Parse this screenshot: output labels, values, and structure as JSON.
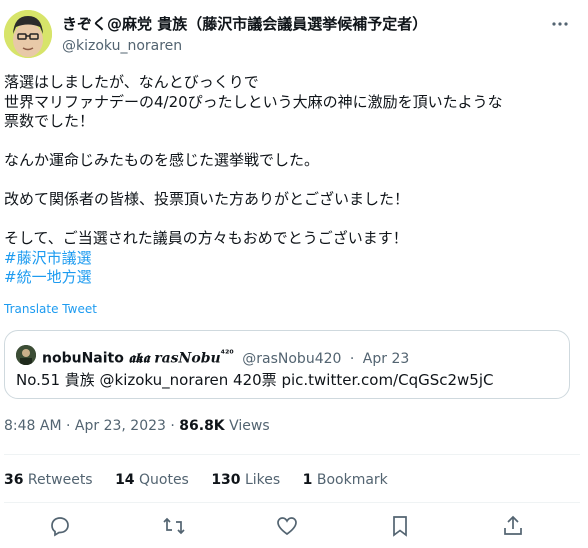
{
  "author": {
    "display_name": "きぞく@麻党 貴族（藤沢市議会議員選挙候補予定者）",
    "handle": "@kizoku_noraren"
  },
  "tweet": {
    "lines": [
      "落選はしましたが、なんとびっくりで",
      "世界マリファナデーの4/20ぴったしという大麻の神に激励を頂いたような",
      "票数でした！",
      "",
      "なんか運命じみたものを感じた選挙戦でした。",
      "",
      "改めて関係者の皆様、投票頂いた方ありがとございました！",
      "",
      "そして、ご当選された議員の方々もおめでとうございます！"
    ],
    "hashtags": [
      "#藤沢市議選",
      "#統一地方選"
    ],
    "translate_label": "Translate Tweet"
  },
  "quote": {
    "name": "nobuNaito",
    "aka": "𝖆𝖐𝖆 𝒓𝒂𝒔𝑵𝒐𝒃𝒖",
    "sup": "⁴²⁰",
    "handle": "@rasNobu420",
    "date": "Apr 23",
    "text": "No.51 貴族 @kizoku_noraren 420票 pic.twitter.com/CqGSc2w5jC"
  },
  "meta": {
    "time": "8:48 AM · Apr 23, 2023 · ",
    "views_count": "86.8K",
    "views_label": " Views"
  },
  "stats": {
    "retweets_count": "36",
    "retweets_label": " Retweets",
    "quotes_count": "14",
    "quotes_label": " Quotes",
    "likes_count": "130",
    "likes_label": " Likes",
    "bookmarks_count": "1",
    "bookmarks_label": " Bookmark"
  },
  "icons": {
    "more": "more-icon",
    "reply": "reply-icon",
    "retweet": "retweet-icon",
    "like": "heart-icon",
    "bookmark": "bookmark-icon",
    "share": "share-icon"
  },
  "colors": {
    "link": "#1d9bf0",
    "secondary_text": "#536471",
    "border": "#cfd9de"
  }
}
